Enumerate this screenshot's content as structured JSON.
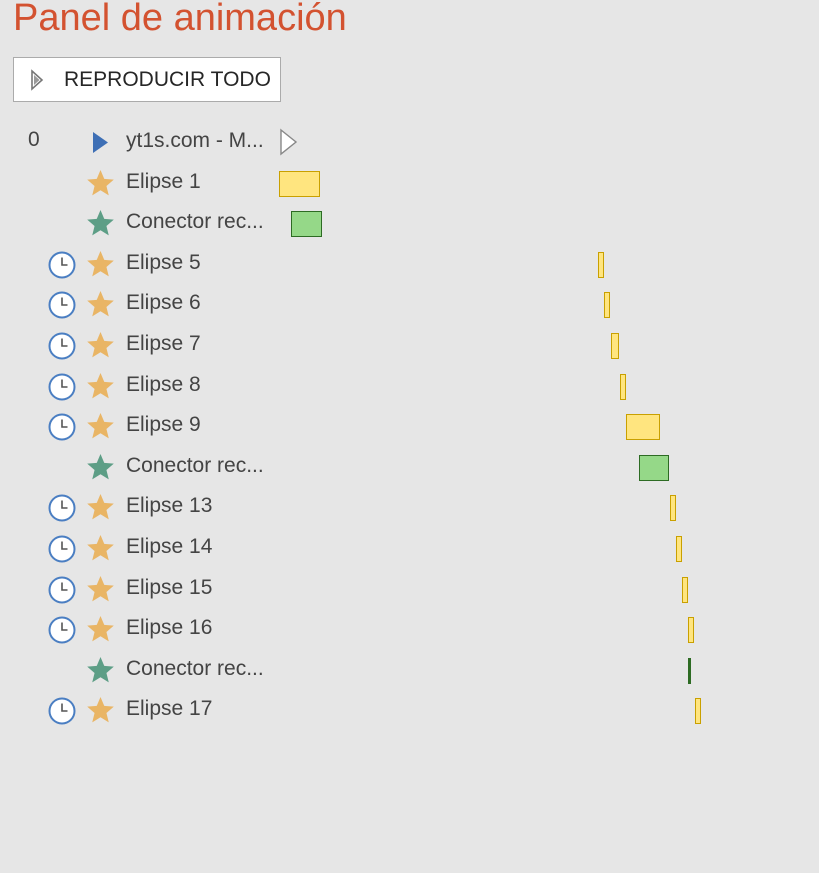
{
  "panel": {
    "title": "Panel de animación",
    "play_all_label": "REPRODUCIR TODO"
  },
  "colors": {
    "title": "#d35230",
    "entrance_star": "#e9b565",
    "path_star": "#5d9e86",
    "clock": "#4a7ec2",
    "trigger": "#3e6fb5",
    "bar_yellow": "#ffe57f",
    "bar_green": "#95d888"
  },
  "animations": [
    {
      "number": "0",
      "icon": "trigger-play-icon",
      "label": "yt1s.com - M...",
      "trigger": "on-click",
      "bar_type": "trigger-outline"
    },
    {
      "number": "",
      "icon": "star-gold-icon",
      "label": "Elipse 1",
      "trigger": "with-previous",
      "bar_type": "yellow"
    },
    {
      "number": "",
      "icon": "star-green-icon",
      "label": "Conector rec...",
      "trigger": "with-previous",
      "bar_type": "green"
    },
    {
      "number": "",
      "icon": "star-gold-icon",
      "label": "Elipse 5",
      "trigger": "after-previous",
      "bar_type": "yellow"
    },
    {
      "number": "",
      "icon": "star-gold-icon",
      "label": "Elipse 6",
      "trigger": "after-previous",
      "bar_type": "yellow"
    },
    {
      "number": "",
      "icon": "star-gold-icon",
      "label": "Elipse 7",
      "trigger": "after-previous",
      "bar_type": "yellow"
    },
    {
      "number": "",
      "icon": "star-gold-icon",
      "label": "Elipse 8",
      "trigger": "after-previous",
      "bar_type": "yellow"
    },
    {
      "number": "",
      "icon": "star-gold-icon",
      "label": "Elipse 9",
      "trigger": "after-previous",
      "bar_type": "yellow"
    },
    {
      "number": "",
      "icon": "star-green-icon",
      "label": "Conector rec...",
      "trigger": "with-previous",
      "bar_type": "green"
    },
    {
      "number": "",
      "icon": "star-gold-icon",
      "label": "Elipse 13",
      "trigger": "after-previous",
      "bar_type": "yellow"
    },
    {
      "number": "",
      "icon": "star-gold-icon",
      "label": "Elipse 14",
      "trigger": "after-previous",
      "bar_type": "yellow"
    },
    {
      "number": "",
      "icon": "star-gold-icon",
      "label": "Elipse 15",
      "trigger": "after-previous",
      "bar_type": "yellow"
    },
    {
      "number": "",
      "icon": "star-gold-icon",
      "label": "Elipse 16",
      "trigger": "after-previous",
      "bar_type": "yellow"
    },
    {
      "number": "",
      "icon": "star-green-icon",
      "label": "Conector rec...",
      "trigger": "with-previous",
      "bar_type": "green-line"
    },
    {
      "number": "",
      "icon": "star-gold-icon",
      "label": "Elipse 17",
      "trigger": "after-previous",
      "bar_type": "yellow"
    }
  ]
}
